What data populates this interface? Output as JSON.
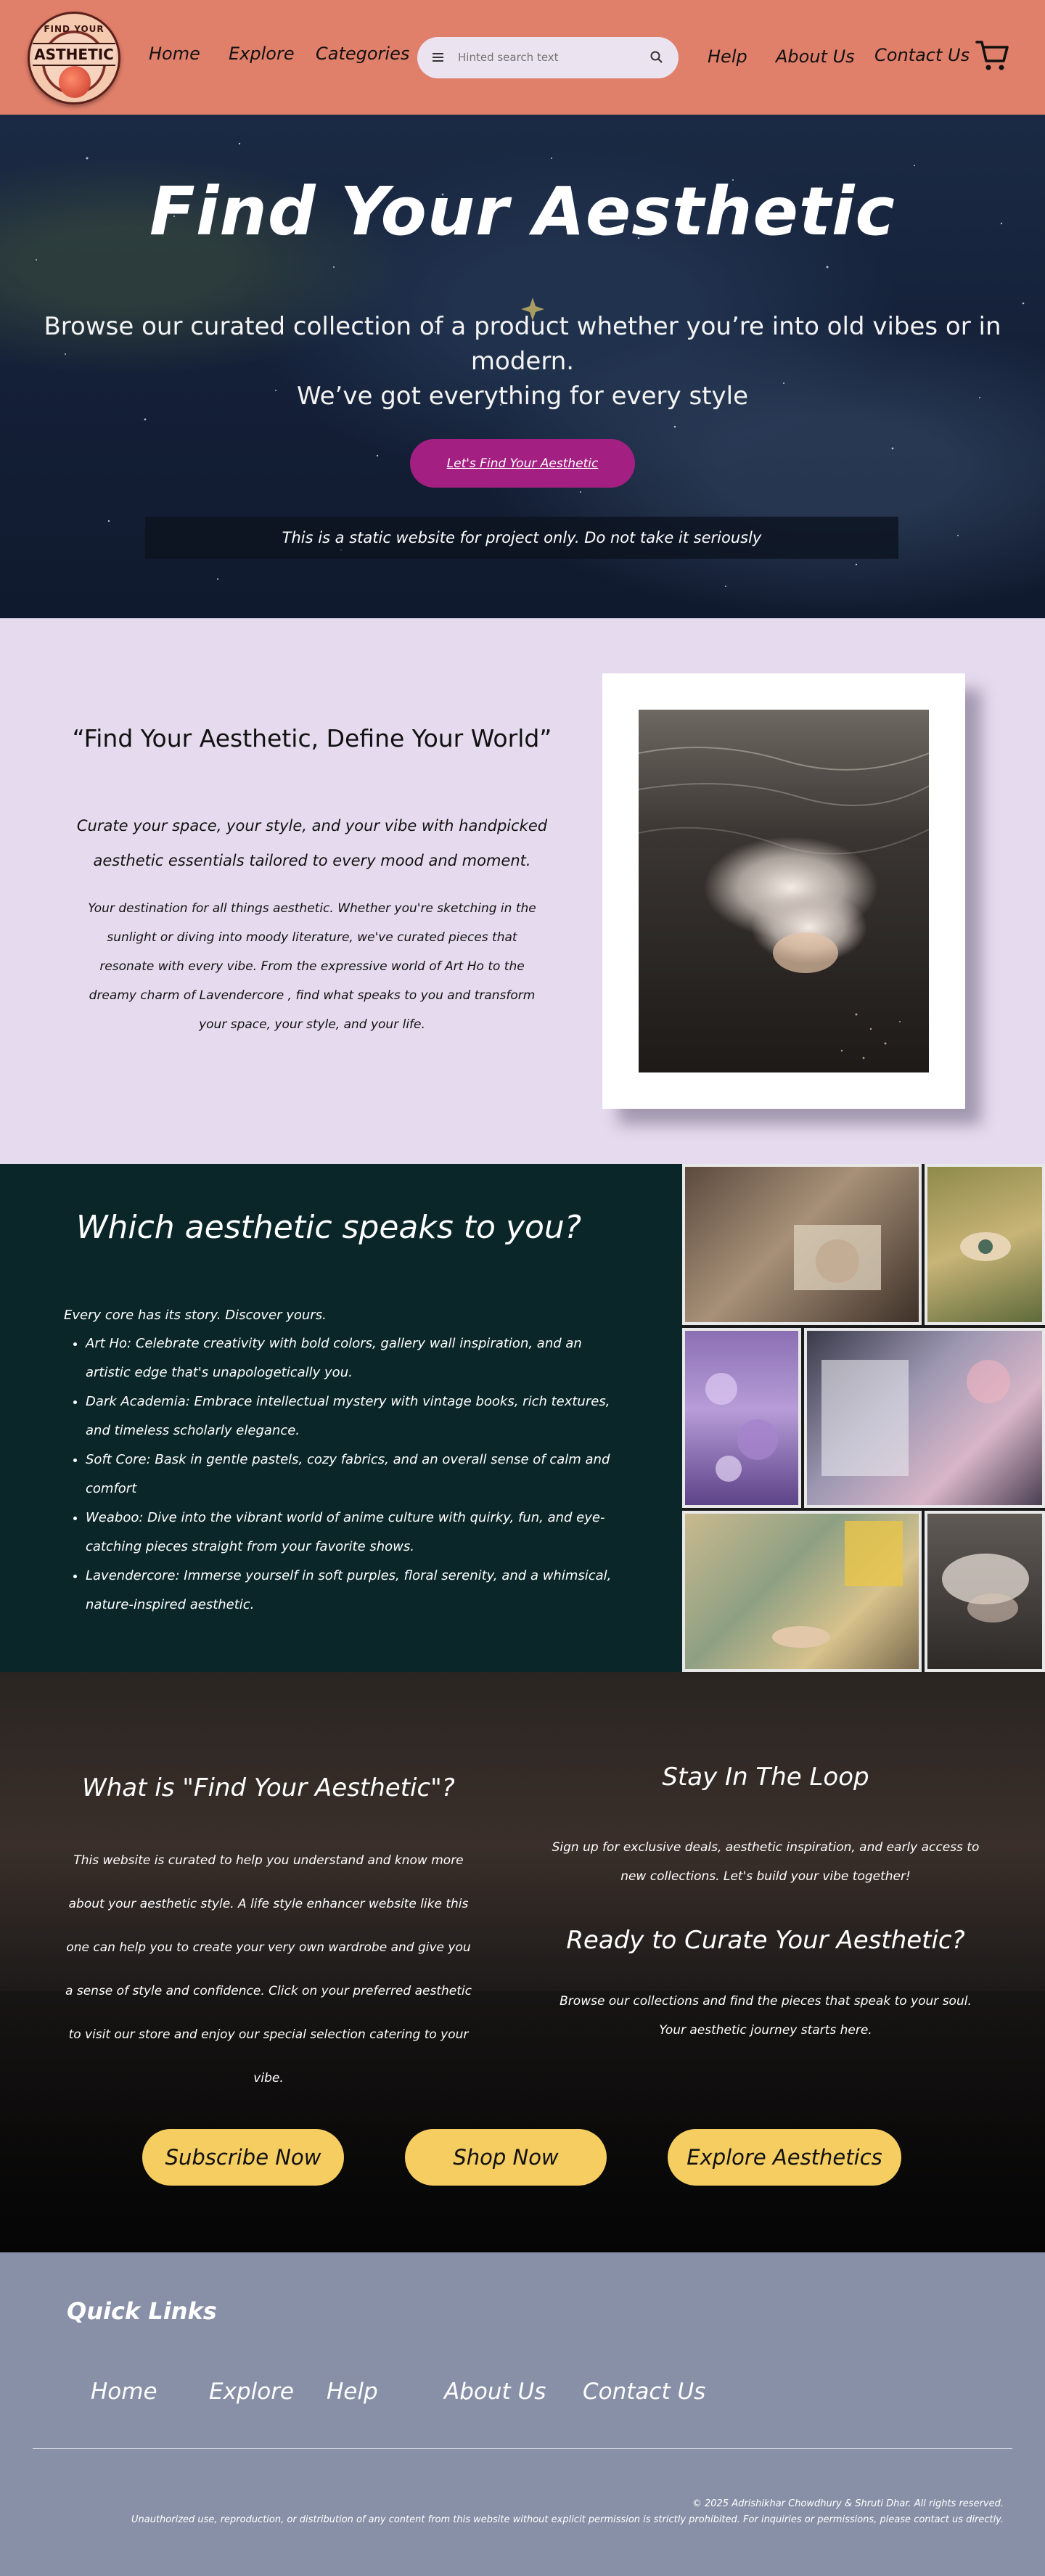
{
  "nav": {
    "logo": {
      "top_text": "FIND YOUR",
      "main_text": "ASTHETIC"
    },
    "links": [
      "Home",
      "Explore",
      "Categories"
    ],
    "search_placeholder": "Hinted search text",
    "right_links": [
      "Help",
      "About Us",
      "Contact Us"
    ],
    "icons": {
      "menu": "menu-icon",
      "search": "search-icon",
      "cart": "cart-icon"
    }
  },
  "hero": {
    "title": "Find Your Aesthetic",
    "subtitle_line1": "Browse our curated collection of a product whether you’re into old vibes or in modern.",
    "subtitle_line2": "We’ve got everything for every style",
    "cta": "Let's Find Your Aesthetic",
    "notice": "This is a static website for project only. Do not take it seriously"
  },
  "intro": {
    "quote": "“Find Your Aesthetic, Define Your World”",
    "lead": "Curate your space, your style, and your vibe with handpicked aesthetic essentials tailored to every mood and moment.",
    "body": "Your destination for all things aesthetic. Whether you're sketching in the sunlight or diving into moody literature, we've curated pieces that resonate with every vibe. From the expressive world of Art Ho to the dreamy charm of Lavendercore , find what speaks to you and transform your space, your style, and your life."
  },
  "aesthetics": {
    "title": "Which aesthetic speaks to you?",
    "intro": "Every core has its story. Discover yours.",
    "items": [
      "Art Ho: Celebrate creativity with bold colors, gallery wall inspiration, and an artistic edge that's unapologetically you.",
      "Dark Academia: Embrace intellectual mystery with vintage books, rich textures, and timeless scholarly elegance.",
      "Soft Core: Bask in gentle pastels, cozy fabrics, and an overall sense of calm and comfort",
      "Weaboo: Dive into the vibrant world of anime culture with quirky, fun, and eye-catching pieces straight from your favorite shows.",
      "Lavendercore: Immerse yourself in soft purples, floral serenity, and a whimsical, nature-inspired aesthetic."
    ]
  },
  "about": {
    "what_title": "What is \"Find Your Aesthetic\"?",
    "what_body": "This website is curated to help you understand and know more about your aesthetic style. A life style enhancer website like this one can help you to create your very own wardrobe and give you a sense of style and confidence. Click on your preferred aesthetic to visit our store and enjoy our special selection catering to your vibe.",
    "loop_title": "Stay In The Loop",
    "loop_body": "Sign up for exclusive deals, aesthetic inspiration, and early access to new collections. Let's build your vibe together!",
    "ready_title": "Ready to Curate Your Aesthetic?",
    "ready_body": "Browse our collections and find the pieces that speak to your soul. Your aesthetic journey starts here.",
    "buttons": [
      "Subscribe Now",
      "Shop Now",
      "Explore Aesthetics"
    ]
  },
  "footer": {
    "title": "Quick Links",
    "links": [
      "Home",
      "Explore",
      "Help",
      "About Us",
      "Contact Us"
    ],
    "copyright": "© 2025 Adrishikhar Chowdhury & Shruti Dhar. All rights reserved.",
    "disclaimer": "Unauthorized use, reproduction, or distribution of any content from this website without explicit permission is strictly prohibited. For inquiries or permissions, please contact us directly."
  },
  "colors": {
    "nav": "#e07f6a",
    "hero_cta": "#a31f82",
    "intro_bg": "#e6dbee",
    "aesthetics_bg": "#0b2628",
    "pill": "#f5cd60",
    "footer_bg": "#8890a8"
  }
}
